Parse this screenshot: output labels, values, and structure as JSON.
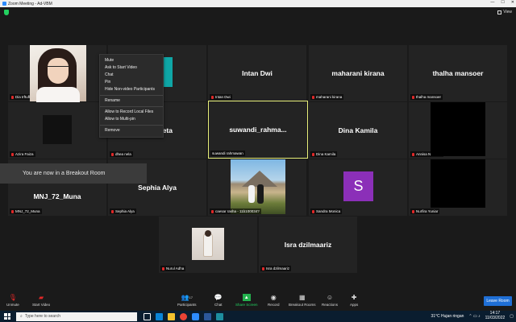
{
  "window": {
    "title": "Zoom Meeting - Ad-VBM",
    "controls": [
      "—",
      "☐",
      "✕"
    ]
  },
  "topbar": {
    "view_label": "View"
  },
  "participants_grid": [
    {
      "name_tag": "Dia trftuflgsn",
      "big_name": ""
    },
    {
      "name_tag": "",
      "big_name": ""
    },
    {
      "name_tag": "Intan Dwi",
      "big_name": "Intan Dwi"
    },
    {
      "name_tag": "maharani kirana",
      "big_name": "maharani kirana"
    },
    {
      "name_tag": "thalha mansoer",
      "big_name": "thalha mansoer"
    },
    {
      "name_tag": "Azira Faiza",
      "big_name": ""
    },
    {
      "name_tag": "dhea nela",
      "big_name": "eta"
    },
    {
      "name_tag": "suwandi rahmawan",
      "big_name": "suwandi_rahma..."
    },
    {
      "name_tag": "Dina Kamila",
      "big_name": "Dina Kamila"
    },
    {
      "name_tag": "Annisa Nur Laili",
      "big_name": ""
    },
    {
      "name_tag": "MNJ_72_Muna",
      "big_name": "MNJ_72_Muna"
    },
    {
      "name_tag": "Sephia Alya",
      "big_name": "Sephia Alya"
    },
    {
      "name_tag": "caesar rasha - 11b100034?",
      "big_name": ""
    },
    {
      "name_tag": "Sandra Monica",
      "big_name": ""
    },
    {
      "name_tag": "Nurfira Yuniar",
      "big_name": ""
    },
    {
      "name_tag": "Nurul Adha",
      "big_name": ""
    },
    {
      "name_tag": "Isra dzilmaariz",
      "big_name": "Isra dzilmaariz"
    }
  ],
  "avatar_letter": "S",
  "context_menu": {
    "items": [
      "Mute",
      "Ask to Start Video",
      "Chat",
      "Pin",
      "Hide Non-video Participants",
      "Rename",
      "Allow to Record Local Files",
      "Allow to Multi-pin",
      "Remove"
    ]
  },
  "toast": {
    "text": "You are now in a Breakout Room"
  },
  "toolbar": {
    "unmute": "Unmute",
    "start_video": "Start Video",
    "participants": "Participants",
    "participants_count": "17",
    "chat": "Chat",
    "share_screen": "Share Screen",
    "record": "Record",
    "breakout_rooms": "Breakout Rooms",
    "reactions": "Reactions",
    "apps": "Apps",
    "leave": "Leave Room"
  },
  "taskbar": {
    "search_placeholder": "Type here to search",
    "weather": "31°C  Hujan ringan",
    "time": "14:17",
    "date": "11/03/2022"
  },
  "colors": {
    "accent": "#2d8cff",
    "leave": "#1f6fd6",
    "speaking_border": "#e8f07a",
    "avatar": "#8b2fb8"
  }
}
